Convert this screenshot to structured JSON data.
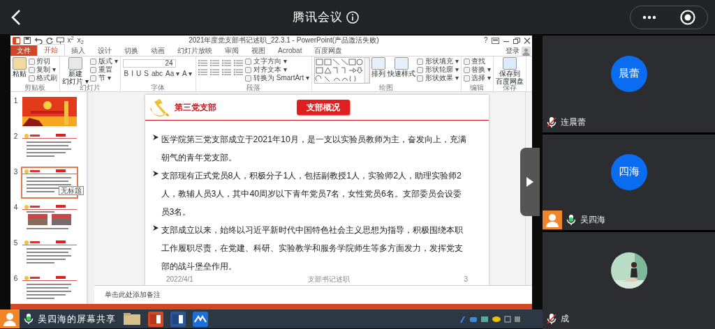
{
  "app": {
    "title": "腾讯会议"
  },
  "ppt": {
    "quick_access": [
      "x$^{2}$",
      "x$_{2}$"
    ],
    "title": "2021年度党支部书记述职_22.3.1 - PowerPoint(产品激活失败)",
    "help": "?",
    "tabs": [
      {
        "label": "文件",
        "kind": "file",
        "selected": false
      },
      {
        "label": "开始",
        "kind": "tab",
        "selected": true
      },
      {
        "label": "插入",
        "kind": "tab",
        "selected": false
      },
      {
        "label": "设计",
        "kind": "tab",
        "selected": false
      },
      {
        "label": "切换",
        "kind": "tab",
        "selected": false
      },
      {
        "label": "动画",
        "kind": "tab",
        "selected": false
      },
      {
        "label": "幻灯片放映",
        "kind": "tab",
        "selected": false
      },
      {
        "label": "审阅",
        "kind": "tab",
        "selected": false
      },
      {
        "label": "视图",
        "kind": "tab",
        "selected": false
      },
      {
        "label": "Acrobat",
        "kind": "tab",
        "selected": false
      },
      {
        "label": "百度网盘",
        "kind": "tab",
        "selected": false
      }
    ],
    "login": "登录",
    "groups": [
      {
        "label": "剪贴板",
        "items": [
          {
            "kind": "large",
            "lines": [
              "粘贴"
            ]
          },
          {
            "kind": "small",
            "label": "剪切"
          },
          {
            "kind": "small",
            "label": "复制 ▾"
          },
          {
            "kind": "small",
            "label": "格式刷"
          }
        ]
      },
      {
        "label": "幻灯片",
        "items": [
          {
            "kind": "large",
            "lines": [
              "新建",
              "幻灯片 ▾"
            ]
          },
          {
            "kind": "small",
            "label": "版式 ▾"
          },
          {
            "kind": "small",
            "label": "重置"
          },
          {
            "kind": "small",
            "label": "节 ▾"
          }
        ]
      },
      {
        "label": "字体",
        "items": [
          {
            "kind": "field",
            "value": "24"
          },
          {
            "kind": "glyphs",
            "labels": [
              "B",
              "I",
              "U",
              "S",
              "abc",
              "Aa ▾",
              "A ▾"
            ]
          }
        ]
      },
      {
        "label": "段落",
        "items": [
          {
            "kind": "para-tools"
          },
          {
            "kind": "small",
            "label": "文字方向 ▾"
          },
          {
            "kind": "small",
            "label": "对齐文本 ▾"
          },
          {
            "kind": "small",
            "label": "转换为 SmartArt ▾"
          }
        ]
      },
      {
        "label": "绘图",
        "items": [
          {
            "kind": "shapes"
          },
          {
            "kind": "large",
            "lines": [
              "排列"
            ]
          },
          {
            "kind": "large",
            "lines": [
              "快速样式"
            ]
          },
          {
            "kind": "small",
            "label": "形状填充 ▾"
          },
          {
            "kind": "small",
            "label": "形状轮廓 ▾"
          },
          {
            "kind": "small",
            "label": "形状效果 ▾"
          }
        ]
      },
      {
        "label": "编辑",
        "items": [
          {
            "kind": "small",
            "label": "查找"
          },
          {
            "kind": "small",
            "label": "替换 ▾"
          },
          {
            "kind": "small",
            "label": "选择 ▾"
          }
        ]
      },
      {
        "label": "保存",
        "items": [
          {
            "kind": "large",
            "lines": [
              "保存到",
              "百度网盘"
            ]
          }
        ]
      }
    ],
    "thumbnails": [
      {
        "number": "1",
        "kind": "title",
        "selected": false
      },
      {
        "number": "2",
        "kind": "content",
        "selected": false
      },
      {
        "number": "3",
        "kind": "content",
        "selected": true,
        "tooltip": "无标题"
      },
      {
        "number": "4",
        "kind": "photos",
        "selected": false
      },
      {
        "number": "5",
        "kind": "content",
        "selected": false
      },
      {
        "number": "6",
        "kind": "content",
        "selected": false
      }
    ],
    "slide": {
      "branch": "第三党支部",
      "heading": "支部概况",
      "bullets": [
        "医学院第三党支部成立于2021年10月，是一支以实验员教师为主，奋发向上，充满朝气的青年党支部。",
        "支部现有正式党员8人，积极分子1人，包括副教授1人，实验师2人，助理实验师2人，教辅人员3人，其中40周岁以下青年党员7名，女性党员6名。支部委员会设委员3名。",
        "支部成立以来，始终以习近平新时代中国特色社会主义思想为指导，积极围绕本职工作履职尽责，在党建、科研、实验教学和服务学院师生等多方面发力，发挥党支部的战斗堡垒作用。"
      ],
      "footer_date": "2022/4/1",
      "footer_title": "支部书记述职",
      "footer_page": "3"
    },
    "notes_placeholder": "单击此处添加备注"
  },
  "participants": [
    {
      "avatar": "晨蕾",
      "kind": "initials",
      "name": "连晨蕾",
      "muted": true,
      "presenting": false
    },
    {
      "avatar": "四海",
      "kind": "initials",
      "name": "吴四海",
      "muted": false,
      "presenting": true
    },
    {
      "kind": "picture",
      "name": "成",
      "muted": true,
      "presenting": false
    }
  ],
  "share_banner": {
    "text": "吴四海的屏幕共享",
    "muted": false
  }
}
